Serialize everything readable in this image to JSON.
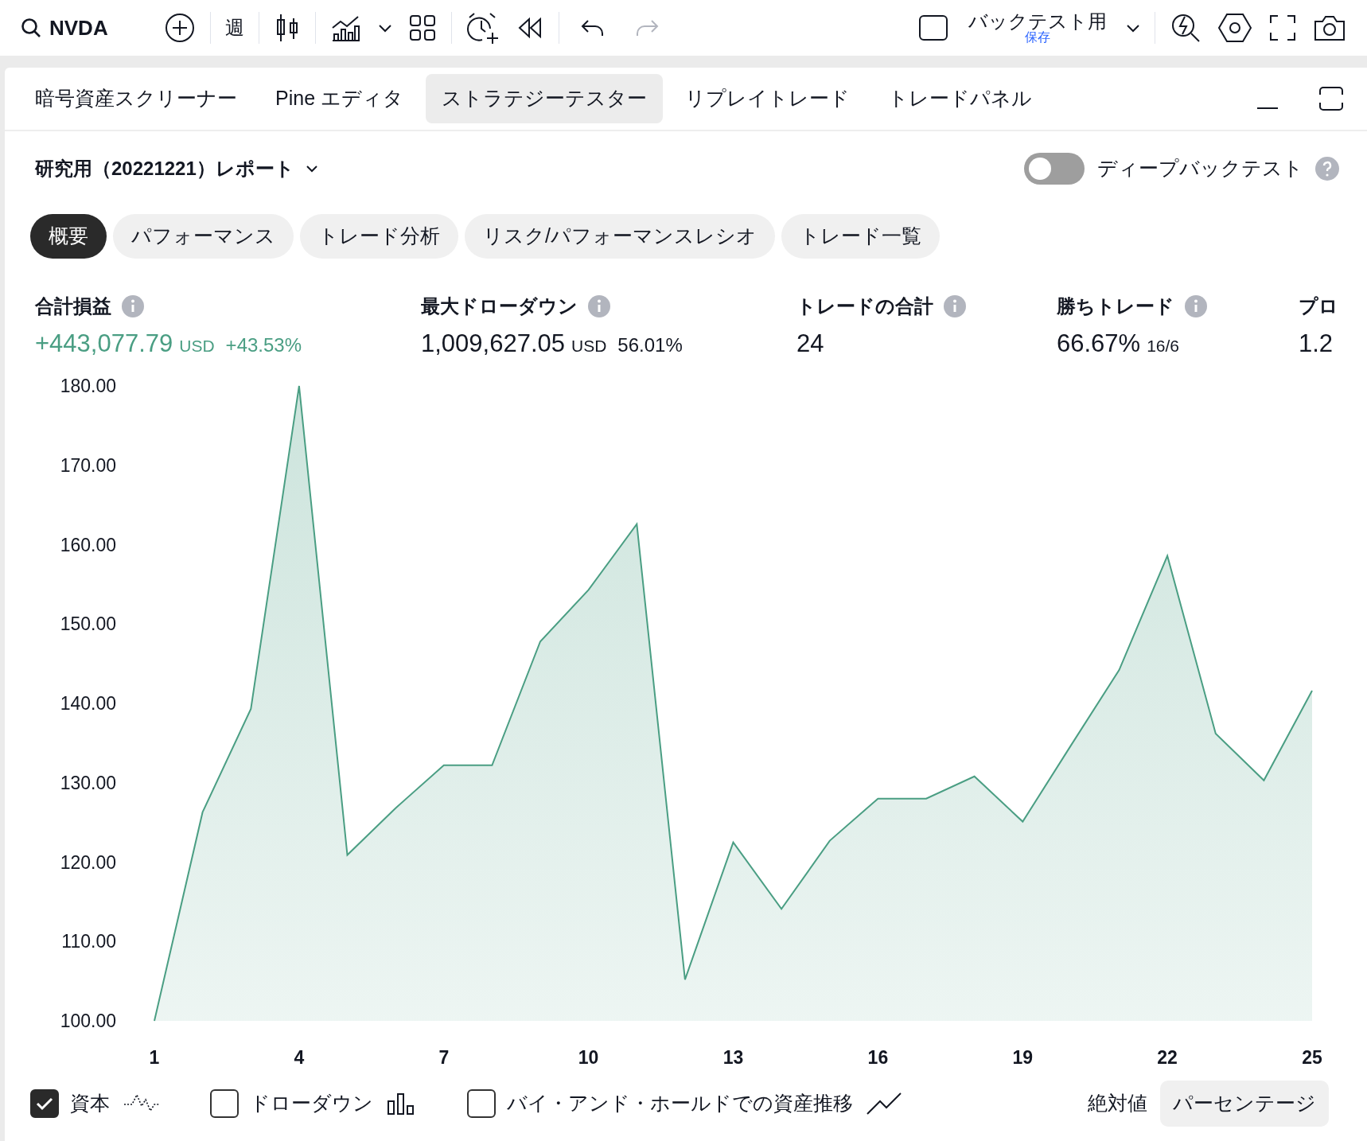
{
  "toolbar": {
    "symbol": "NVDA",
    "interval": "週",
    "layout": {
      "title": "バックテスト用",
      "status": "保存"
    },
    "history": [
      {
        "kind": "undo",
        "disabled": false
      },
      {
        "kind": "redo",
        "disabled": true
      }
    ]
  },
  "panel_tabs": [
    {
      "label": "暗号資産スクリーナー",
      "selected": false
    },
    {
      "label": "Pine エディタ",
      "selected": false
    },
    {
      "label": "ストラテジーテスター",
      "selected": true
    },
    {
      "label": "リプレイトレード",
      "selected": false
    },
    {
      "label": "トレードパネル",
      "selected": false
    }
  ],
  "report": {
    "title": "研究用（20221221）レポート",
    "deep_backtest": {
      "label": "ディープバックテスト",
      "on": false
    },
    "tabs": [
      {
        "label": "概要",
        "selected": true
      },
      {
        "label": "パフォーマンス",
        "selected": false
      },
      {
        "label": "トレード分析",
        "selected": false
      },
      {
        "label": "リスク/パフォーマンスレシオ",
        "selected": false
      },
      {
        "label": "トレード一覧",
        "selected": false
      }
    ],
    "metrics": [
      {
        "label": "合計損益",
        "value": "+443,077.79",
        "unit": "USD",
        "change": "+43.53%",
        "kind": "positive"
      },
      {
        "label": "最大ドローダウン",
        "value": "1,009,627.05",
        "unit": "USD",
        "change": "56.01%",
        "kind": "neutral"
      },
      {
        "label": "トレードの合計",
        "value": "24",
        "kind": "neutral"
      },
      {
        "label": "勝ちトレード",
        "value": "66.67%",
        "detail": "16/6",
        "kind": "neutral"
      },
      {
        "label": "プロ",
        "value": "1.2",
        "kind": "cut"
      }
    ],
    "chart_data": {
      "type": "area",
      "x": [
        1,
        2,
        3,
        4,
        5,
        6,
        7,
        8,
        9,
        10,
        11,
        12,
        13,
        14,
        15,
        16,
        17,
        18,
        19,
        20,
        21,
        22,
        23,
        24,
        25
      ],
      "series": [
        {
          "name": "資本",
          "color": "#4a9e83",
          "values": [
            100.0,
            126.3,
            139.3,
            180.0,
            120.9,
            126.8,
            132.2,
            132.2,
            147.8,
            154.3,
            162.6,
            105.2,
            122.5,
            114.1,
            122.7,
            128.0,
            128.0,
            130.8,
            125.1,
            134.7,
            144.2,
            158.6,
            136.2,
            130.3,
            141.6
          ]
        }
      ],
      "xlim": [
        1,
        25
      ],
      "ylim": [
        100,
        180
      ],
      "yticks": [
        {
          "value": 100,
          "label": "100.00"
        },
        {
          "value": 110,
          "label": "110.00"
        },
        {
          "value": 120,
          "label": "120.00"
        },
        {
          "value": 130,
          "label": "130.00"
        },
        {
          "value": 140,
          "label": "140.00"
        },
        {
          "value": 150,
          "label": "150.00"
        },
        {
          "value": 160,
          "label": "160.00"
        },
        {
          "value": 170,
          "label": "170.00"
        },
        {
          "value": 180,
          "label": "180.00"
        }
      ],
      "xticks": [
        1,
        4,
        7,
        10,
        13,
        16,
        19,
        22,
        25
      ]
    },
    "legend": [
      {
        "checked": true,
        "kind": "equity"
      },
      {
        "label": "ドローダウン",
        "checked": false,
        "kind": "drawdown"
      },
      {
        "label": "バイ・アンド・ホールドでの資産推移",
        "checked": false,
        "kind": "buyhold"
      }
    ],
    "scale_modes": [
      {
        "label": "絶対値",
        "selected": false
      },
      {
        "label": "パーセンテージ",
        "selected": true
      }
    ]
  }
}
